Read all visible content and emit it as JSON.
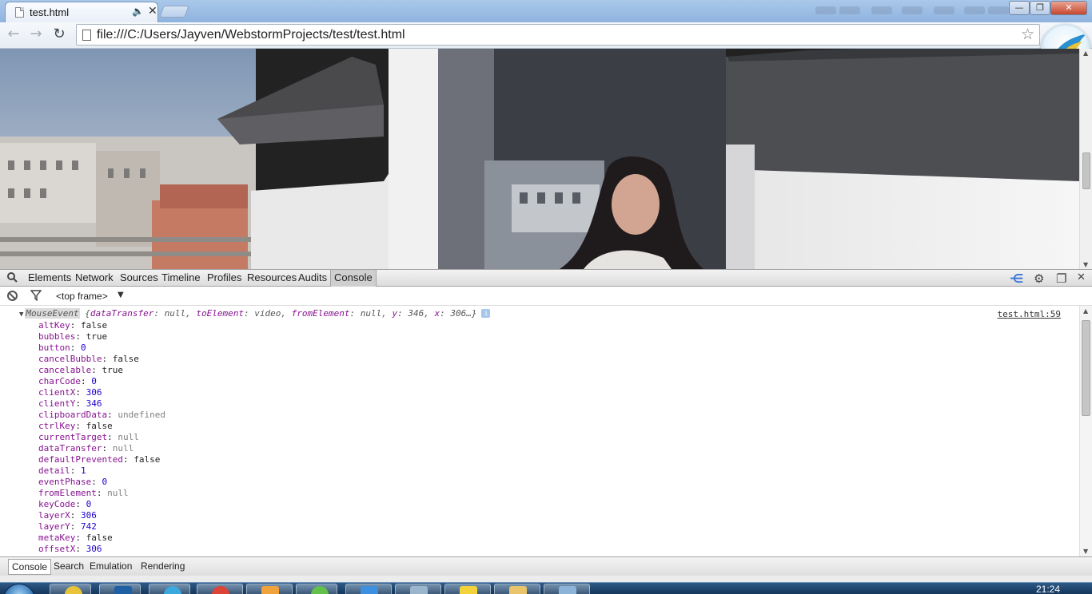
{
  "browser": {
    "tab_title": "test.html",
    "url": "file:///C:/Users/Jayven/WebstormProjects/test/test.html",
    "window_buttons": {
      "minimize": "—",
      "maximize": "❐",
      "close": "✕"
    }
  },
  "devtools": {
    "tabs": [
      "Elements",
      "Network",
      "Sources",
      "Timeline",
      "Profiles",
      "Resources",
      "Audits",
      "Console"
    ],
    "active_tab": "Console",
    "frame_selector": "<top frame>",
    "drawer_tabs": [
      "Console",
      "Search",
      "Emulation",
      "Rendering"
    ],
    "active_drawer_tab": "Console"
  },
  "console": {
    "source_link": "test.html:59",
    "object_class": "MouseEvent",
    "object_preview": [
      {
        "key": "dataTransfer",
        "value": "null"
      },
      {
        "key": "toElement",
        "value": "video"
      },
      {
        "key": "fromElement",
        "value": "null"
      },
      {
        "key": "y",
        "value": "346"
      },
      {
        "key": "x",
        "value": "306…"
      }
    ],
    "properties": [
      {
        "key": "altKey",
        "value": "false",
        "kind": "bool"
      },
      {
        "key": "bubbles",
        "value": "true",
        "kind": "bool"
      },
      {
        "key": "button",
        "value": "0",
        "kind": "num"
      },
      {
        "key": "cancelBubble",
        "value": "false",
        "kind": "bool"
      },
      {
        "key": "cancelable",
        "value": "true",
        "kind": "bool"
      },
      {
        "key": "charCode",
        "value": "0",
        "kind": "num"
      },
      {
        "key": "clientX",
        "value": "306",
        "kind": "num"
      },
      {
        "key": "clientY",
        "value": "346",
        "kind": "num"
      },
      {
        "key": "clipboardData",
        "value": "undefined",
        "kind": "nul"
      },
      {
        "key": "ctrlKey",
        "value": "false",
        "kind": "bool"
      },
      {
        "key": "currentTarget",
        "value": "null",
        "kind": "nul"
      },
      {
        "key": "dataTransfer",
        "value": "null",
        "kind": "nul"
      },
      {
        "key": "defaultPrevented",
        "value": "false",
        "kind": "bool"
      },
      {
        "key": "detail",
        "value": "1",
        "kind": "num"
      },
      {
        "key": "eventPhase",
        "value": "0",
        "kind": "num"
      },
      {
        "key": "fromElement",
        "value": "null",
        "kind": "nul"
      },
      {
        "key": "keyCode",
        "value": "0",
        "kind": "num"
      },
      {
        "key": "layerX",
        "value": "306",
        "kind": "num"
      },
      {
        "key": "layerY",
        "value": "742",
        "kind": "num"
      },
      {
        "key": "metaKey",
        "value": "false",
        "kind": "bool"
      },
      {
        "key": "offsetX",
        "value": "306",
        "kind": "num"
      }
    ]
  },
  "taskbar": {
    "clock": "21:24"
  }
}
